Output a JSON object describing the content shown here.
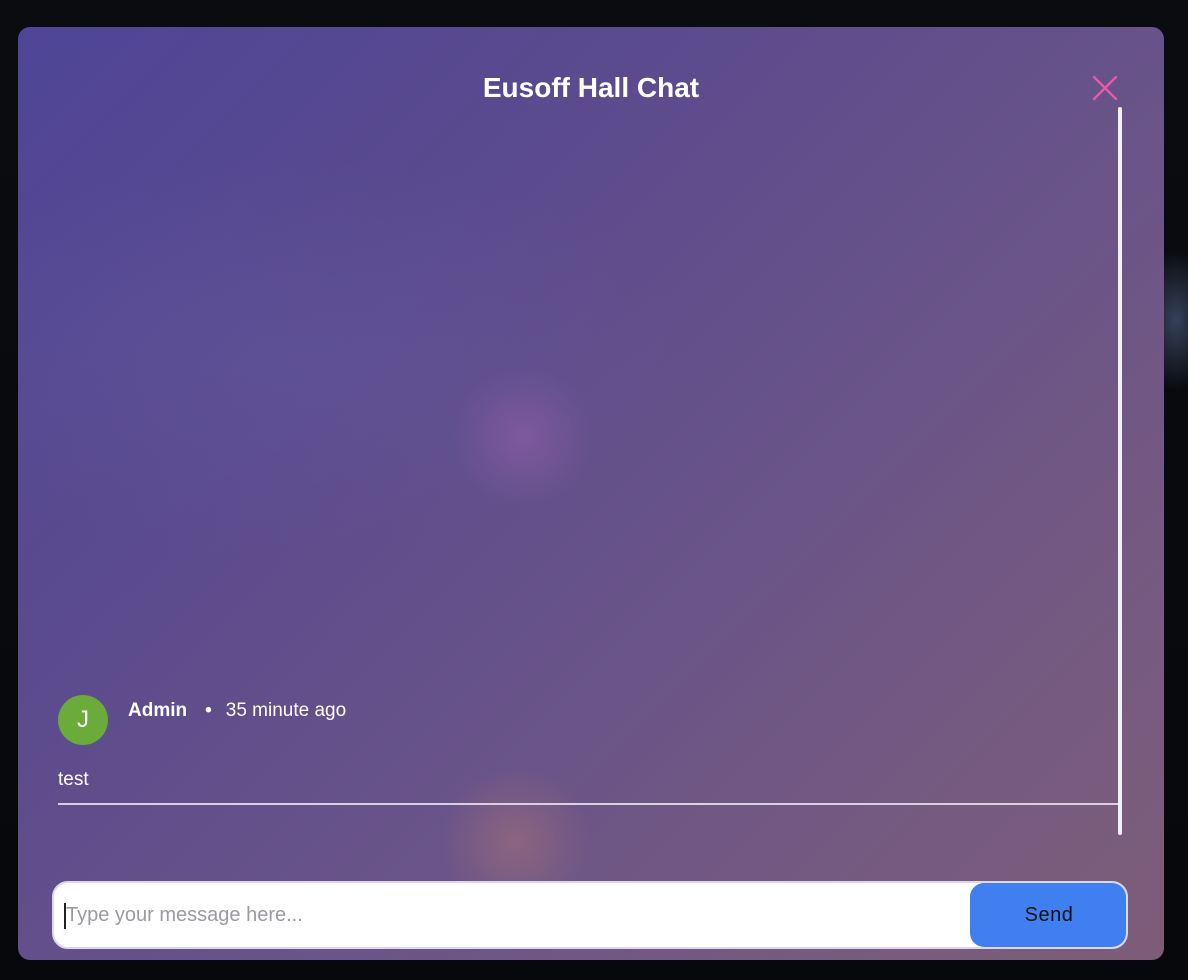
{
  "chat": {
    "title": "Eusoff Hall Chat",
    "close_icon": "close-icon",
    "accent_color": "#e85aa8"
  },
  "messages": [
    {
      "avatar_initial": "J",
      "avatar_color": "#6aab3a",
      "author": "Admin",
      "separator": "•",
      "time": "35 minute ago",
      "text": "test"
    }
  ],
  "composer": {
    "placeholder": "Type your message here...",
    "value": "",
    "send_label": "Send",
    "send_color": "#3f7ff0"
  }
}
